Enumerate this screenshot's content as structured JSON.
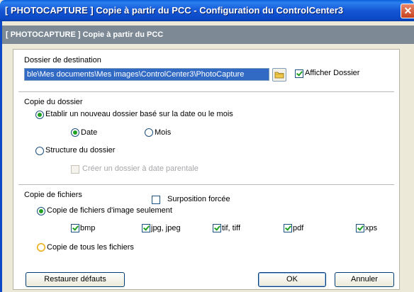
{
  "window": {
    "title": "[ PHOTOCAPTURE ]  Copie à partir du PCC - Configuration du ControlCenter3",
    "close_glyph": "✕"
  },
  "banner": {
    "text": "[ PHOTOCAPTURE ]   Copie à partir du PCC"
  },
  "destination": {
    "label": "Dossier de destination",
    "path_value": "ble\\Mes documents\\Mes images\\ControlCenter3\\PhotoCapture",
    "show_folder_label": "Afficher Dossier",
    "show_folder_checked": true
  },
  "folder_copy": {
    "label": "Copie du dossier",
    "option_new_folder": "Etablir un nouveau dossier basé sur la date ou le mois",
    "option_new_folder_selected": true,
    "date_label": "Date",
    "date_selected": true,
    "month_label": "Mois",
    "month_selected": false,
    "option_structure": "Structure du dossier",
    "option_structure_selected": false,
    "parent_date_label": "Créer un dossier à date parentale",
    "parent_date_checked": false
  },
  "file_copy": {
    "label": "Copie de fichiers",
    "overwrite_label": "Surposition forcée",
    "overwrite_checked": false,
    "option_images_only": "Copie de fichiers d'image seulement",
    "option_images_only_selected": true,
    "types": [
      {
        "label": "bmp",
        "checked": true
      },
      {
        "label": "jpg, jpeg",
        "checked": true
      },
      {
        "label": "tif, tiff",
        "checked": true
      },
      {
        "label": "pdf",
        "checked": true
      },
      {
        "label": "xps",
        "checked": true
      }
    ],
    "option_all_files": "Copie de tous les fichiers",
    "option_all_files_selected": false
  },
  "buttons": {
    "restore": "Restaurer défauts",
    "ok": "OK",
    "cancel": "Annuler"
  },
  "colors": {
    "titlebar": "#0b49c6",
    "banner": "#7d8a96",
    "selection": "#316ac5",
    "check_green": "#21a121"
  }
}
